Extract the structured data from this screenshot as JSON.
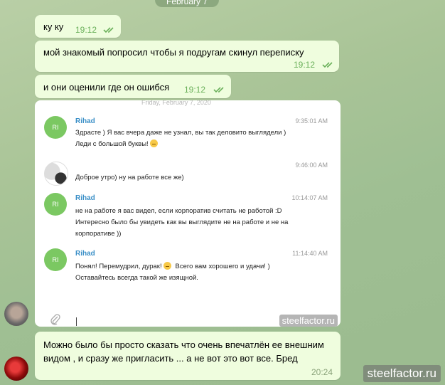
{
  "date_pill": "February 7",
  "messages": [
    {
      "text": "ку ку",
      "time": "19:12"
    },
    {
      "text": "мой знакомый попросил чтобы я подругам скинул переписку",
      "time": "19:12"
    },
    {
      "text": "и они оценили где он ошибся",
      "time": "19:12"
    },
    {
      "text": "Можно было бы просто сказать что очень впечатлён ее внешним видом , и сразу же пригласить ... а не вот это вот все. Бред",
      "time": "20:24"
    }
  ],
  "screenshot": {
    "date": "Friday, February 7, 2020",
    "messages": [
      {
        "avatar": "RI",
        "name": "Rihad",
        "time": "9:35:01 AM",
        "text": "Здрасте ) Я вас вчера даже не узнал, вы так деловито выглядели ) Леди с большой буквы!"
      },
      {
        "avatar": "",
        "name": "",
        "time": "9:46:00 AM",
        "text": "Доброе утро) ну на работе все же)"
      },
      {
        "avatar": "RI",
        "name": "Rihad",
        "time": "10:14:07 AM",
        "text": "не на работе я вас видел, если корпоратив считать не работой :D Интересно было бы увидеть как вы выглядите не на работе и не на корпоративе ))"
      },
      {
        "avatar": "RI",
        "name": "Rihad",
        "time": "11:14:40 AM",
        "text_a": "Понял! Перемудрил, дурак!",
        "text_b": "Всего вам хорошего и удачи! ) Оставайтесь всегда такой же изящной."
      }
    ],
    "watermark": "steelfactor.ru"
  },
  "site_watermark": "steelfactor.ru",
  "colors": {
    "bubble": "#effdde",
    "time_green": "#6ab05a",
    "name_blue": "#3a8fc7",
    "avatar_green": "#7bc862"
  }
}
